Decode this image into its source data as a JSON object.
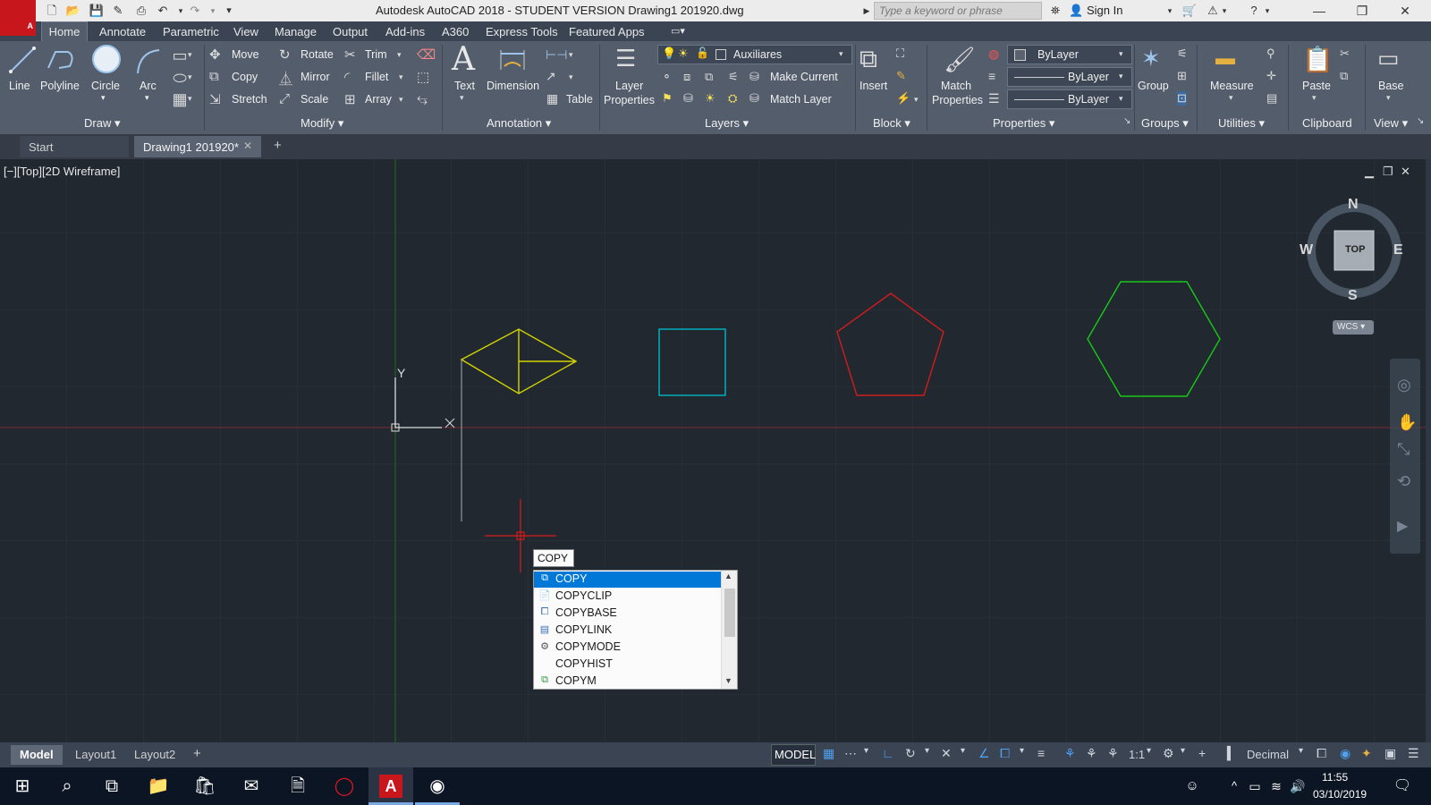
{
  "app": {
    "logo": "A",
    "logo_sub": "CAD",
    "window_title": "Autodesk AutoCAD 2018 - STUDENT VERSION    Drawing1 201920.dwg",
    "search_placeholder": "Type a keyword or phrase",
    "sign_in": "Sign In"
  },
  "ribbon_tabs": [
    "Home",
    "Annotate",
    "Parametric",
    "View",
    "Manage",
    "Output",
    "Add-ins",
    "A360",
    "Express Tools",
    "Featured Apps"
  ],
  "draw": {
    "line": "Line",
    "polyline": "Polyline",
    "circle": "Circle",
    "arc": "Arc",
    "title": "Draw"
  },
  "modify": {
    "move": "Move",
    "rotate": "Rotate",
    "trim": "Trim",
    "copy": "Copy",
    "mirror": "Mirror",
    "fillet": "Fillet",
    "stretch": "Stretch",
    "scale": "Scale",
    "array": "Array",
    "title": "Modify"
  },
  "annotation": {
    "text": "Text",
    "dimension": "Dimension",
    "table": "Table",
    "title": "Annotation"
  },
  "layers": {
    "layer_properties_1": "Layer",
    "layer_properties_2": "Properties",
    "current_layer": "Auxiliares",
    "make_current": "Make Current",
    "match_layer": "Match Layer",
    "title": "Layers"
  },
  "block": {
    "insert": "Insert",
    "title": "Block"
  },
  "properties": {
    "match_1": "Match",
    "match_2": "Properties",
    "color": "ByLayer",
    "linetype": "ByLayer",
    "lineweight": "ByLayer",
    "title": "Properties"
  },
  "groups": {
    "group": "Group",
    "title": "Groups"
  },
  "utilities": {
    "measure": "Measure",
    "title": "Utilities"
  },
  "clipboard": {
    "paste": "Paste",
    "title": "Clipboard"
  },
  "view_panel": {
    "base": "Base",
    "title": "View"
  },
  "doc_tabs": {
    "start": "Start",
    "drawing": "Drawing1 201920*"
  },
  "viewport": {
    "label": "[−][Top][2D Wireframe]"
  },
  "viewcube": {
    "n": "N",
    "s": "S",
    "e": "E",
    "w": "W",
    "top": "TOP",
    "wcs": "WCS"
  },
  "ucs": {
    "x": "X",
    "y": "Y"
  },
  "command": {
    "input": "COPY",
    "suggestions": [
      "COPY",
      "COPYCLIP",
      "COPYBASE",
      "COPYLINK",
      "COPYMODE",
      "COPYHIST",
      "COPYM"
    ],
    "selected": "COPY"
  },
  "layout_tabs": [
    "Model",
    "Layout1",
    "Layout2"
  ],
  "status": {
    "model": "MODEL",
    "scale": "1:1",
    "units": "Decimal"
  },
  "taskbar": {
    "time": "11:55",
    "date": "03/10/2019"
  },
  "colors": {
    "shape_yellow": "#d4d400",
    "shape_cyan": "#00b8c4",
    "shape_red": "#d01c1c",
    "shape_green": "#18c818",
    "ucs_red": "#7a2a34",
    "ucs_green": "#1f6b1f",
    "crosshair": "#d81b1b"
  }
}
